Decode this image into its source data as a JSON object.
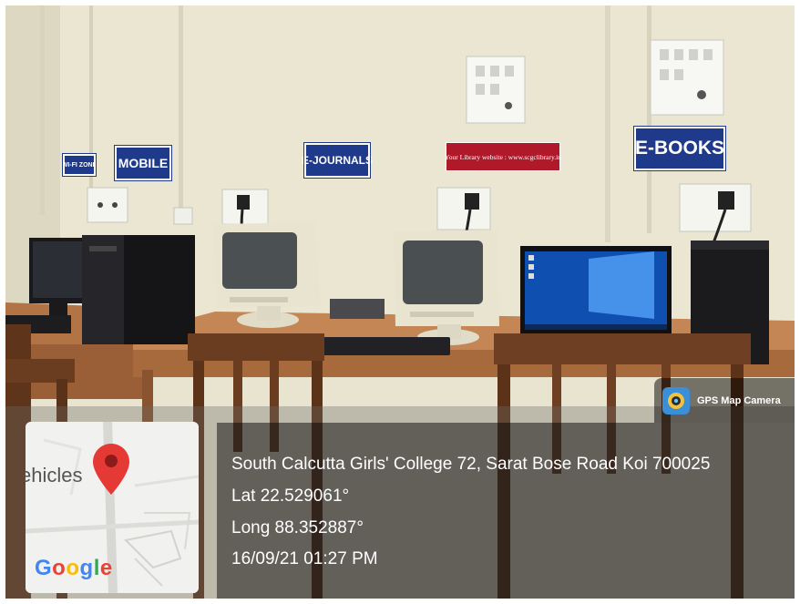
{
  "signs": {
    "wifi_zone": "WI-FI ZONE",
    "mobile": "MOBILE",
    "ejournals": "E-JOURNALS",
    "library_website": "Your Library website : www.scgclibrary.in",
    "ebooks": "E-BOOKS"
  },
  "gps_badge": {
    "label": "GPS Map Camera",
    "icon": "gps-camera-app-icon"
  },
  "location": {
    "address": "South Calcutta Girls' College 72, Sarat Bose Road Koi 700025",
    "latitude": "Lat 22.529061°",
    "longitude": "Long 88.352887°",
    "datetime": "16/09/21 01:27 PM"
  },
  "minimap": {
    "place_label": "ehicles",
    "brand": "Google",
    "pin": "map-pin-icon"
  },
  "colors": {
    "sign_blue": "#1f3a8a",
    "sign_red": "#b0192a",
    "pin_red": "#e53935",
    "overlay": "#000000"
  }
}
